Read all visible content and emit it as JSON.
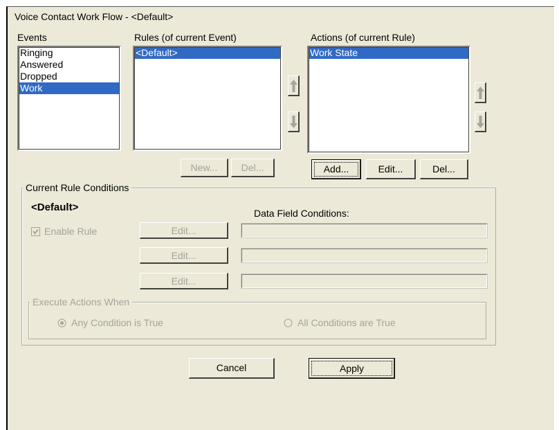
{
  "window": {
    "title": "Voice Contact Work Flow - <Default>"
  },
  "events": {
    "label": "Events",
    "items": [
      {
        "label": "Ringing",
        "selected": false
      },
      {
        "label": "Answered",
        "selected": false
      },
      {
        "label": "Dropped",
        "selected": false
      },
      {
        "label": "Work",
        "selected": true
      }
    ]
  },
  "rules": {
    "label": "Rules (of current Event)",
    "items": [
      {
        "label": "<Default>",
        "selected": true
      }
    ],
    "new_label": "New...",
    "del_label": "Del..."
  },
  "actions": {
    "label": "Actions (of current Rule)",
    "items": [
      {
        "label": "Work State",
        "selected": true
      }
    ],
    "add_label": "Add...",
    "edit_label": "Edit...",
    "del_label": "Del..."
  },
  "conditions": {
    "group_label": "Current Rule Conditions",
    "rule_name": "<Default>",
    "data_field_label": "Data Field Conditions:",
    "enable_rule_label": "Enable Rule",
    "enable_rule_checked": true,
    "edit_labels": [
      "Edit...",
      "Edit...",
      "Edit..."
    ],
    "field_values": [
      "",
      "",
      ""
    ],
    "execute": {
      "label": "Execute Actions When",
      "any_label": "Any Condition is True",
      "all_label": "All Conditions are True",
      "selected": "any"
    }
  },
  "footer": {
    "cancel_label": "Cancel",
    "apply_label": "Apply"
  },
  "colors": {
    "face": "#ece9d8",
    "selection": "#316ac5",
    "disabled_text": "#a5a39a"
  }
}
